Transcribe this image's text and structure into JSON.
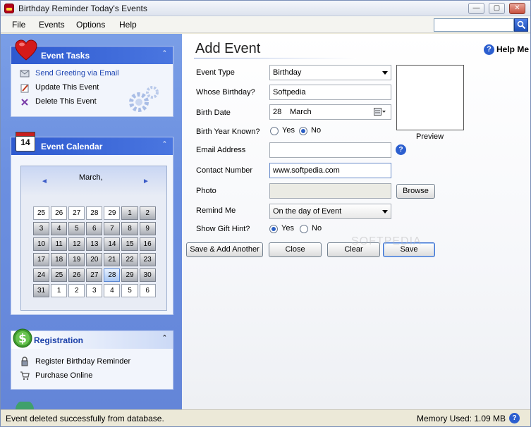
{
  "window": {
    "title": "Birthday Reminder Today's Events",
    "minimize_glyph": "—",
    "maximize_glyph": "▢",
    "close_glyph": "✕"
  },
  "menu": [
    "File",
    "Events",
    "Options",
    "Help"
  ],
  "search": {
    "placeholder": ""
  },
  "sidebar": {
    "event_tasks": {
      "title": "Event Tasks",
      "collapse_glyph": "ˆ",
      "items": [
        {
          "label": "Send Greeting via Email",
          "icon": "email-greeting-icon"
        },
        {
          "label": "Update This Event",
          "icon": "edit-icon"
        },
        {
          "label": "Delete This Event",
          "icon": "delete-icon"
        }
      ]
    },
    "event_calendar": {
      "title": "Event Calendar",
      "icon_day": "14",
      "collapse_glyph": "ˆ",
      "month_label": "March,",
      "prev_glyph": "◄",
      "next_glyph": "►",
      "days": [
        {
          "d": "25",
          "s": "white"
        },
        {
          "d": "26",
          "s": "white"
        },
        {
          "d": "27",
          "s": "white"
        },
        {
          "d": "28",
          "s": "white"
        },
        {
          "d": "29",
          "s": "white"
        },
        {
          "d": "1",
          "s": "gray"
        },
        {
          "d": "2",
          "s": "gray"
        },
        {
          "d": "3",
          "s": "gray"
        },
        {
          "d": "4",
          "s": "gray"
        },
        {
          "d": "5",
          "s": "gray"
        },
        {
          "d": "6",
          "s": "gray"
        },
        {
          "d": "7",
          "s": "gray"
        },
        {
          "d": "8",
          "s": "gray"
        },
        {
          "d": "9",
          "s": "gray"
        },
        {
          "d": "10",
          "s": "gray"
        },
        {
          "d": "11",
          "s": "gray"
        },
        {
          "d": "12",
          "s": "gray"
        },
        {
          "d": "13",
          "s": "gray"
        },
        {
          "d": "14",
          "s": "gray"
        },
        {
          "d": "15",
          "s": "gray"
        },
        {
          "d": "16",
          "s": "gray"
        },
        {
          "d": "17",
          "s": "gray"
        },
        {
          "d": "18",
          "s": "gray"
        },
        {
          "d": "19",
          "s": "gray"
        },
        {
          "d": "20",
          "s": "gray"
        },
        {
          "d": "21",
          "s": "gray"
        },
        {
          "d": "22",
          "s": "gray"
        },
        {
          "d": "23",
          "s": "gray"
        },
        {
          "d": "24",
          "s": "gray"
        },
        {
          "d": "25",
          "s": "gray"
        },
        {
          "d": "26",
          "s": "gray"
        },
        {
          "d": "27",
          "s": "gray"
        },
        {
          "d": "28",
          "s": "today"
        },
        {
          "d": "29",
          "s": "gray"
        },
        {
          "d": "30",
          "s": "gray"
        },
        {
          "d": "31",
          "s": "gray"
        },
        {
          "d": "1",
          "s": "white"
        },
        {
          "d": "2",
          "s": "white"
        },
        {
          "d": "3",
          "s": "white"
        },
        {
          "d": "4",
          "s": "white"
        },
        {
          "d": "5",
          "s": "white"
        },
        {
          "d": "6",
          "s": "white"
        }
      ]
    },
    "registration": {
      "title": "Registration",
      "collapse_glyph": "ˆ",
      "items": [
        {
          "label": "Register Birthday Reminder",
          "icon": "lock-icon"
        },
        {
          "label": "Purchase Online",
          "icon": "cart-icon"
        }
      ]
    }
  },
  "form": {
    "title": "Add Event",
    "help_label": "Help Me",
    "help_glyph": "?",
    "event_type": {
      "label": "Event Type",
      "value": "Birthday"
    },
    "whose_birthday": {
      "label": "Whose Birthday?",
      "value": "Softpedia"
    },
    "birth_date": {
      "label": "Birth Date",
      "day": "28",
      "month": "March"
    },
    "birth_year_known": {
      "label": "Birth Year Known?",
      "yes": "Yes",
      "no": "No",
      "selected": "no"
    },
    "email": {
      "label": "Email Address",
      "value": ""
    },
    "contact": {
      "label": "Contact Number",
      "value": "www.softpedia.com"
    },
    "photo": {
      "label": "Photo",
      "value": "",
      "browse_label": "Browse"
    },
    "remind_me": {
      "label": "Remind Me",
      "value": "On the day of Event"
    },
    "gift_hint": {
      "label": "Show Gift Hint?",
      "yes": "Yes",
      "no": "No",
      "selected": "yes"
    },
    "preview_label": "Preview",
    "buttons": {
      "save_add": "Save & Add Another",
      "close": "Close",
      "clear": "Clear",
      "save": "Save"
    },
    "watermark": "SOFTPEDIA"
  },
  "status": {
    "message": "Event deleted successfully from database.",
    "memory": "Memory Used: 1.09 MB",
    "memory_glyph": "?"
  },
  "colors": {
    "accent": "#2e5ad0",
    "sidebar": "#6b8fe0",
    "window": "#ece9d8"
  }
}
